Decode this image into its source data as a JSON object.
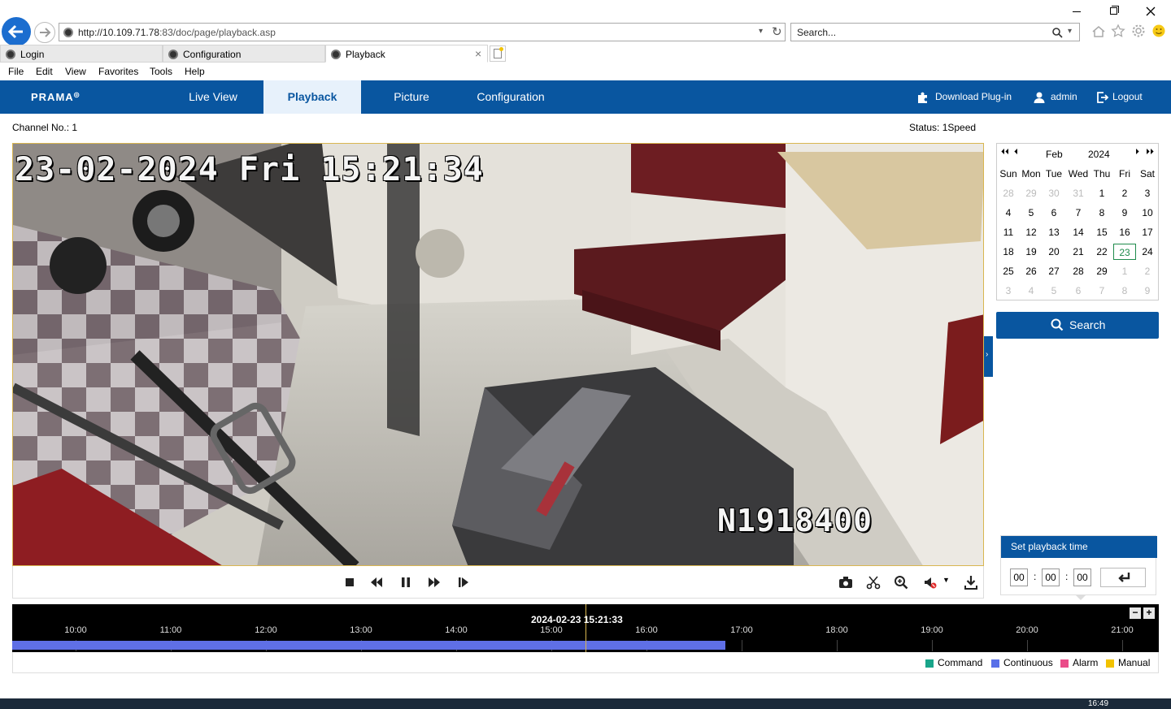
{
  "browser": {
    "url_host": "http://10.109.71.78",
    "url_path": ":83/doc/page/playback.asp",
    "search_placeholder": "Search...",
    "tabs": [
      {
        "label": "Login"
      },
      {
        "label": "Configuration"
      },
      {
        "label": "Playback"
      }
    ],
    "menu": [
      "File",
      "Edit",
      "View",
      "Favorites",
      "Tools",
      "Help"
    ]
  },
  "app": {
    "brand": "PRAMA",
    "nav": [
      "Live View",
      "Playback",
      "Picture",
      "Configuration"
    ],
    "active_nav": "Playback",
    "download_plugin": "Download Plug-in",
    "user": "admin",
    "logout": "Logout",
    "accent": "#0956a0"
  },
  "status": {
    "channel": "Channel No.: 1",
    "state": "Status: 1Speed"
  },
  "video": {
    "osd_datetime": "23-02-2024 Fri 15:21:34",
    "osd_id": "N1918400"
  },
  "calendar": {
    "month": "Feb",
    "year": "2024",
    "weekdays": [
      "Sun",
      "Mon",
      "Tue",
      "Wed",
      "Thu",
      "Fri",
      "Sat"
    ],
    "weeks": [
      [
        "28",
        "29",
        "30",
        "31",
        "1",
        "2",
        "3"
      ],
      [
        "4",
        "5",
        "6",
        "7",
        "8",
        "9",
        "10"
      ],
      [
        "11",
        "12",
        "13",
        "14",
        "15",
        "16",
        "17"
      ],
      [
        "18",
        "19",
        "20",
        "21",
        "22",
        "23",
        "24"
      ],
      [
        "25",
        "26",
        "27",
        "28",
        "29",
        "1",
        "2"
      ],
      [
        "3",
        "4",
        "5",
        "6",
        "7",
        "8",
        "9"
      ]
    ],
    "selected": "23",
    "search_label": "Search"
  },
  "playback_time": {
    "title": "Set playback time",
    "hh": "00",
    "mm": "00",
    "ss": "00"
  },
  "timeline": {
    "current": "2024-02-23 15:21:33",
    "hours": [
      "10:00",
      "11:00",
      "12:00",
      "13:00",
      "14:00",
      "15:00",
      "16:00",
      "17:00",
      "18:00",
      "19:00",
      "20:00",
      "21:00"
    ],
    "recorded_until": "17:00"
  },
  "legend": [
    {
      "label": "Command",
      "color": "#19a58a"
    },
    {
      "label": "Continuous",
      "color": "#5970e8"
    },
    {
      "label": "Alarm",
      "color": "#ea4c89"
    },
    {
      "label": "Manual",
      "color": "#f2c200"
    }
  ],
  "clock": "16:49"
}
